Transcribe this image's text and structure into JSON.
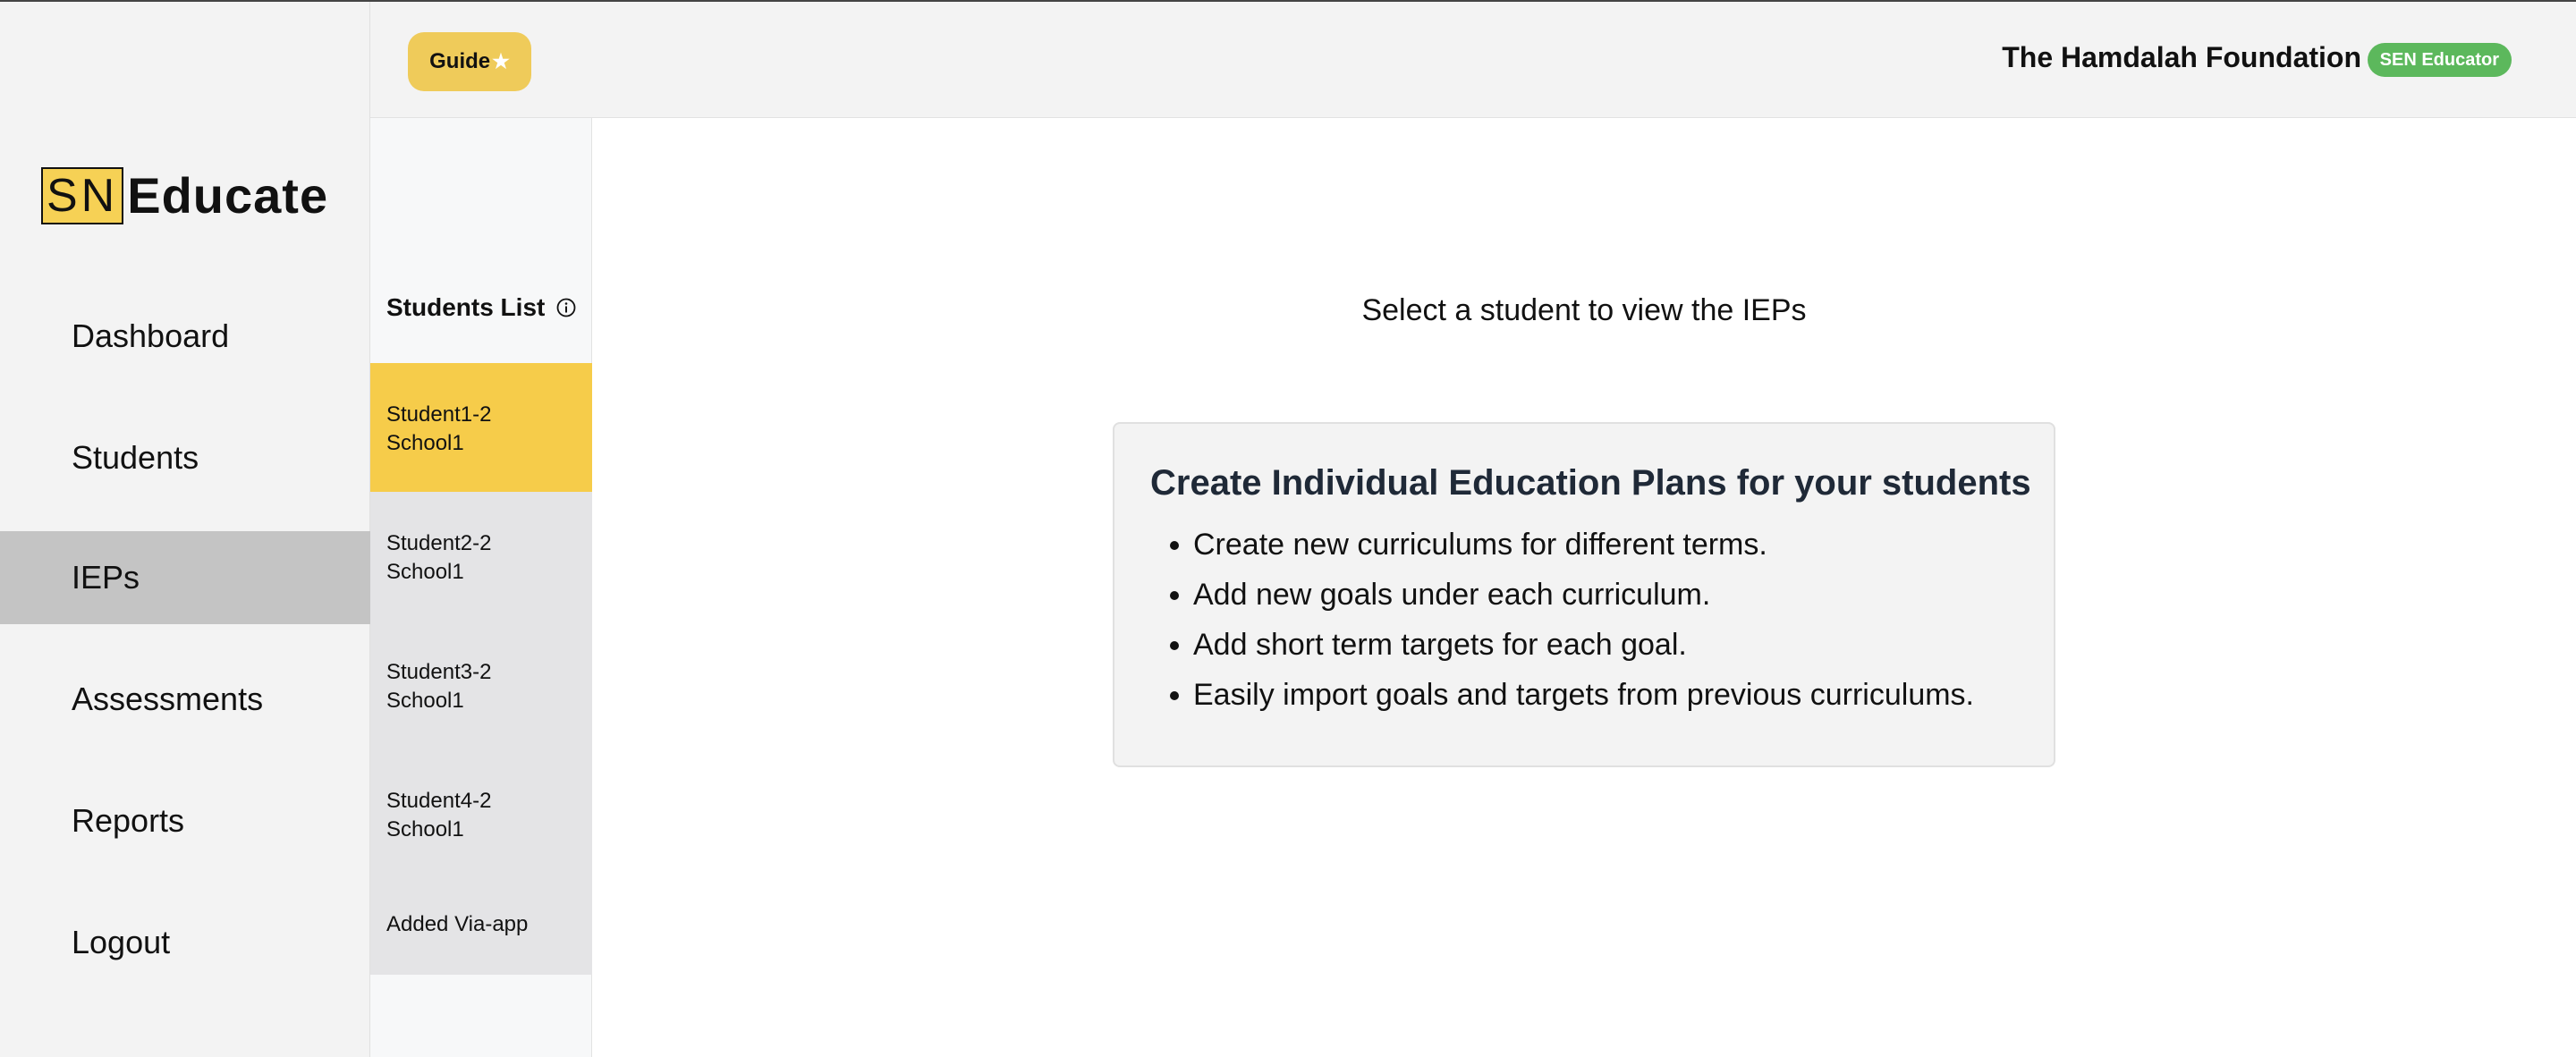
{
  "brand": {
    "logo_boxed": "SN",
    "logo_text": "Educate"
  },
  "sidebar": {
    "items": [
      {
        "label": "Dashboard",
        "active": false
      },
      {
        "label": "Students",
        "active": false
      },
      {
        "label": "IEPs",
        "active": true
      },
      {
        "label": "Assessments",
        "active": false
      },
      {
        "label": "Reports",
        "active": false
      },
      {
        "label": "Logout",
        "active": false
      }
    ]
  },
  "header": {
    "guide_label": "Guide",
    "guide_icon": "star-icon",
    "org_name": "The Hamdalah Foundation",
    "role_badge": "SEN Educator"
  },
  "students_panel": {
    "title": "Students List",
    "info_icon": "info-icon",
    "students": [
      {
        "line1": "Student1-2",
        "line2": "School1",
        "selected": true
      },
      {
        "line1": "Student2-2",
        "line2": "School1",
        "selected": false
      },
      {
        "line1": "Student3-2",
        "line2": "School1",
        "selected": false
      },
      {
        "line1": "Student4-2",
        "line2": "School1",
        "selected": false
      },
      {
        "line1": "Added Via-app",
        "line2": "",
        "selected": false
      }
    ]
  },
  "main": {
    "prompt": "Select a student to view the IEPs",
    "card": {
      "title": "Create Individual Education Plans for your students",
      "bullets": [
        "Create new curriculums for different terms.",
        "Add new goals under each curriculum.",
        "Add short term targets for each goal.",
        "Easily import goals and targets from previous curriculums."
      ]
    }
  },
  "colors": {
    "accent_yellow": "#f6cc4a",
    "badge_green": "#5cb85c",
    "active_nav": "#c4c4c4"
  }
}
